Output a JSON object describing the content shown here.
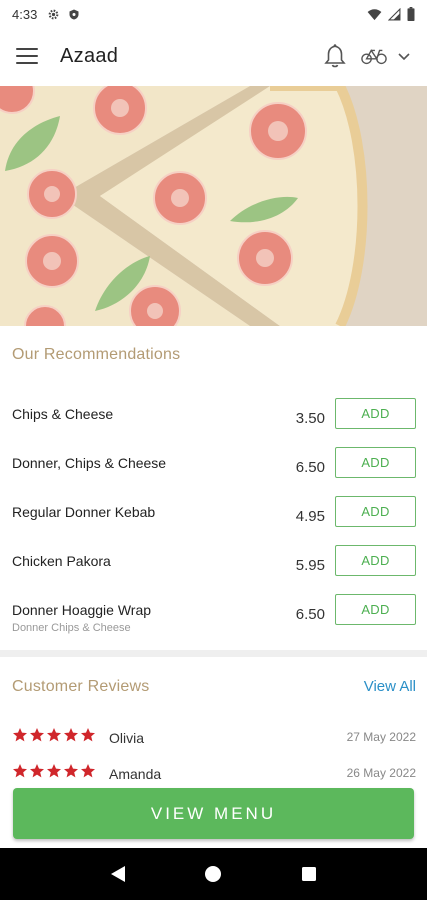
{
  "status_bar": {
    "time": "4:33",
    "left_icons": [
      "gear-icon",
      "shield-icon"
    ],
    "right_icons": [
      "wifi-icon",
      "signal-icon",
      "battery-icon"
    ]
  },
  "app_bar": {
    "title": "Azaad",
    "menu_icon": "hamburger-icon",
    "actions": [
      "bell-icon",
      "bicycle-icon",
      "chevron-down-icon"
    ]
  },
  "hero": {
    "image": "pizza-slices-photo"
  },
  "recommendations": {
    "title": "Our Recommendations",
    "add_label": "ADD",
    "items": [
      {
        "name": "Chips & Cheese",
        "subtitle": "",
        "price": "3.50"
      },
      {
        "name": "Donner, Chips & Cheese",
        "subtitle": "",
        "price": "6.50"
      },
      {
        "name": "Regular Donner Kebab",
        "subtitle": "",
        "price": "4.95"
      },
      {
        "name": "Chicken Pakora",
        "subtitle": "",
        "price": "5.95"
      },
      {
        "name": "Donner Hoaggie  Wrap",
        "subtitle": "Donner Chips & Cheese",
        "price": "6.50"
      }
    ]
  },
  "reviews": {
    "title": "Customer Reviews",
    "view_all": "View All",
    "items": [
      {
        "name": "Olivia",
        "date": "27 May 2022",
        "rating": 5
      },
      {
        "name": "Amanda",
        "date": "26 May 2022",
        "rating": 5
      }
    ]
  },
  "view_menu": {
    "label": "VIEW MENU"
  },
  "colors": {
    "accent_green": "#5cb85c",
    "section_title": "#b39b74",
    "link_blue": "#2a8fc7",
    "star_red": "#d0262b"
  },
  "nav_bar": {
    "buttons": [
      "back-icon",
      "home-icon",
      "recents-icon"
    ]
  }
}
